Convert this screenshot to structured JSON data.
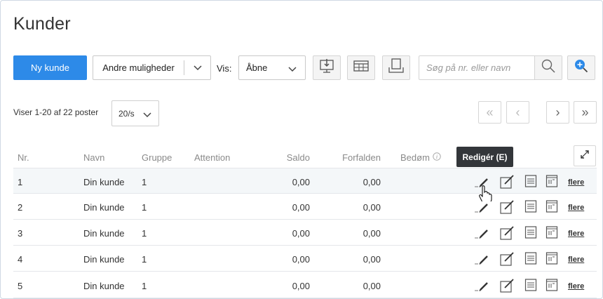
{
  "page": {
    "title": "Kunder"
  },
  "toolbar": {
    "new_customer_label": "Ny kunde",
    "more_options_label": "Andre muligheder",
    "show_label": "Vis:",
    "show_value": "Åbne",
    "search_placeholder": "Søg på nr. eller navn"
  },
  "paging": {
    "count_text": "Viser 1-20 af 22 poster",
    "per_page_value": "20/s",
    "first_glyph": "«",
    "prev_glyph": "‹",
    "next_glyph": "›",
    "last_glyph": "»"
  },
  "table": {
    "headers": [
      "Nr.",
      "Navn",
      "Gruppe",
      "Attention",
      "Saldo",
      "Forfalden",
      "Bedøm"
    ],
    "tooltip": "Redigér (E)",
    "more_label": "flere",
    "rows": [
      {
        "nr": "1",
        "navn": "Din kunde",
        "gruppe": "1",
        "saldo": "0,00",
        "forfalden": "0,00"
      },
      {
        "nr": "2",
        "navn": "Din kunde",
        "gruppe": "1",
        "saldo": "0,00",
        "forfalden": "0,00"
      },
      {
        "nr": "3",
        "navn": "Din kunde",
        "gruppe": "1",
        "saldo": "0,00",
        "forfalden": "0,00"
      },
      {
        "nr": "4",
        "navn": "Din kunde",
        "gruppe": "1",
        "saldo": "0,00",
        "forfalden": "0,00"
      },
      {
        "nr": "5",
        "navn": "Din kunde",
        "gruppe": "1",
        "saldo": "0,00",
        "forfalden": "0,00"
      }
    ]
  },
  "icons": {
    "toolbar": [
      "download-icon",
      "table-icon",
      "print-icon",
      "search-icon",
      "add-search-icon"
    ],
    "row_actions": [
      "pencil-icon",
      "edit-box-icon",
      "list-icon",
      "card-icon"
    ]
  },
  "colors": {
    "accent": "#2d8ae8",
    "tooltip_bg": "#33363a",
    "row_highlight": "#f4f7f9"
  }
}
